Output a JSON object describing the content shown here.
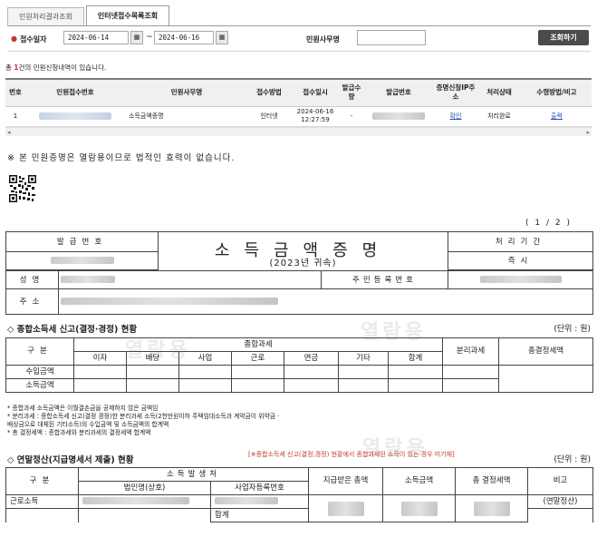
{
  "tabs": [
    {
      "label": "민원처리결과조회",
      "active": false
    },
    {
      "label": "인터넷접수목록조회",
      "active": true
    }
  ],
  "search": {
    "date_label": "접수일자",
    "date_from": "2024-06-14",
    "date_to": "2024-06-16",
    "tilde": "~",
    "office_label": "민원사무명",
    "office_value": "",
    "button_label": "조회하기",
    "calendar_icon": "calendar-icon"
  },
  "result": {
    "prefix": "총",
    "count": "1",
    "suffix": "건의 민원신청내역이 있습니다."
  },
  "list": {
    "headers": [
      "번호",
      "민원접수번호",
      "민원사무명",
      "접수방법",
      "접수일시",
      "발급수량",
      "발급번호",
      "증명신청IP주소",
      "처리상태",
      "수령방법/비고"
    ],
    "rows": [
      {
        "no": "1",
        "office": "소득금액증명",
        "method": "인터넷",
        "date": "2024-06-16",
        "time": "12:27:59",
        "qty": "-",
        "ip_link": "확인",
        "status": "처리완료",
        "receive_link": "출력"
      }
    ]
  },
  "notice": "※ 본 민원증명은 열람용이므로 법적인 효력이 없습니다.",
  "certificate": {
    "page": "( 1 / 2 )",
    "issue_no_label": "발급번호",
    "title": "소득금액증명",
    "period_label": "처리기간",
    "period_value": "즉시",
    "year_caption": "(2023년 귀속)",
    "name_label": "성명",
    "rrn_label": "주민등록번호",
    "address_label": "주소",
    "watermark": "열람용",
    "section1": {
      "heading": "◇ 종합소득세 신고(결정·경정) 현황",
      "unit": "(단위 : 원)",
      "col_group": "구분",
      "comprehensive": "종합과세",
      "separate": "분리과세",
      "total_tax": "총결정세액",
      "cols": [
        "이자",
        "배당",
        "사업",
        "근로",
        "연금",
        "기타",
        "합계"
      ],
      "rows": [
        "수입금액",
        "소득금액"
      ]
    },
    "notes": [
      "* 종합과세 소득금액은 이월결손금을 공제하지 않은 금액임",
      "* 분리과세 : 종합소득세 신고(결정 경정)한 분리과세 소득(2천만원이하 주택임대소득과 계약금이 위약금 ·",
      "   배상금으로 대체된 기타소득)의 수입금액 및 소득금액의 합계액",
      "* 총 결정세액 : 종합과세와 분리과세의 결정세액 합계액"
    ],
    "section2": {
      "heading": "◇ 연말정산(지급명세서 제출) 현황",
      "warning": "[※종합소득세 신고(결정,경정) 현황에서 종합과세된 소득이 있는 경우 미기재]",
      "unit": "(단위 : 원)",
      "col_group": "구분",
      "payer": "소득발생처",
      "payer_name": "법인명(상호)",
      "biz_no": "사업자등록번호",
      "paid": "지급받은 총액",
      "income": "소득금액",
      "total_tax": "총 결정세액",
      "note": "비고",
      "row_label": "근로소득",
      "sum_label": "합계",
      "row_note": "(연말정산)"
    }
  }
}
